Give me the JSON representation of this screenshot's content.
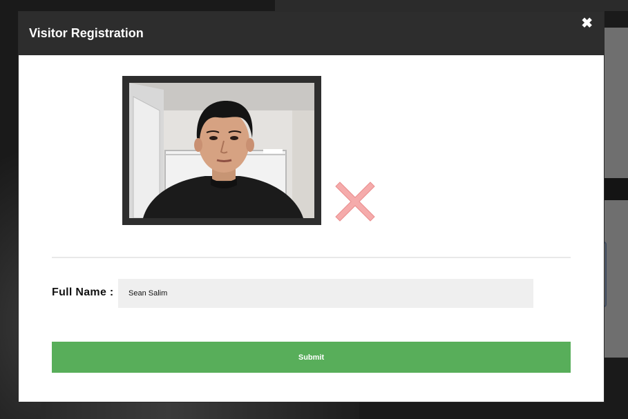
{
  "modal": {
    "title": "Visitor Registration",
    "close_icon": "close-icon",
    "remove_photo_icon": "remove-photo-icon"
  },
  "form": {
    "full_name_label": "Full Name :",
    "full_name_value": "Sean Salim",
    "submit_label": "Submit"
  },
  "colors": {
    "header_bg": "#2d2d2d",
    "submit_bg": "#58ae5a",
    "remove_icon": "#f4a6a6",
    "input_bg": "#efefef"
  }
}
